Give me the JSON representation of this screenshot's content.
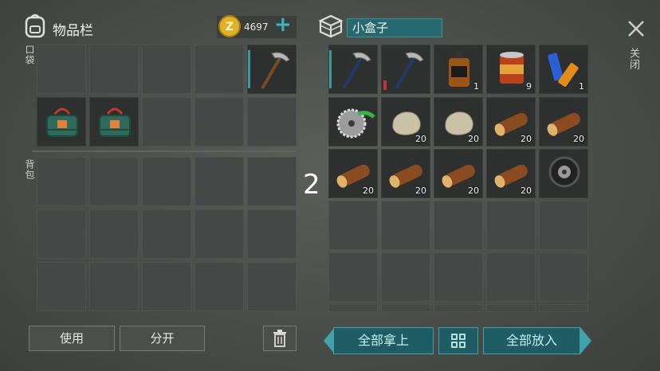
{
  "left_panel": {
    "title": "物品栏",
    "coins": "4697",
    "add_symbol": "+",
    "pocket_label": "口袋",
    "backpack_label": "背包",
    "use_label": "使用",
    "split_label": "分开"
  },
  "right_panel": {
    "container_name": "小盒子",
    "close_label": "关闭",
    "take_all_label": "全部拿上",
    "put_all_label": "全部放入",
    "page_marker": "2",
    "items": {
      "whiskey_count": "1",
      "canned_food_count": "9",
      "batteries_count": "1",
      "stone_a_count": "20",
      "stone_b_count": "20",
      "log_a_count": "20",
      "log_b_count": "20",
      "log_c_count": "20",
      "log_d_count": "20",
      "log_e_count": "20",
      "log_f_count": "20"
    }
  },
  "colors": {
    "accent": "#3a9aa3",
    "coin": "#e0b22a",
    "button_teal": "#1f5c63"
  }
}
